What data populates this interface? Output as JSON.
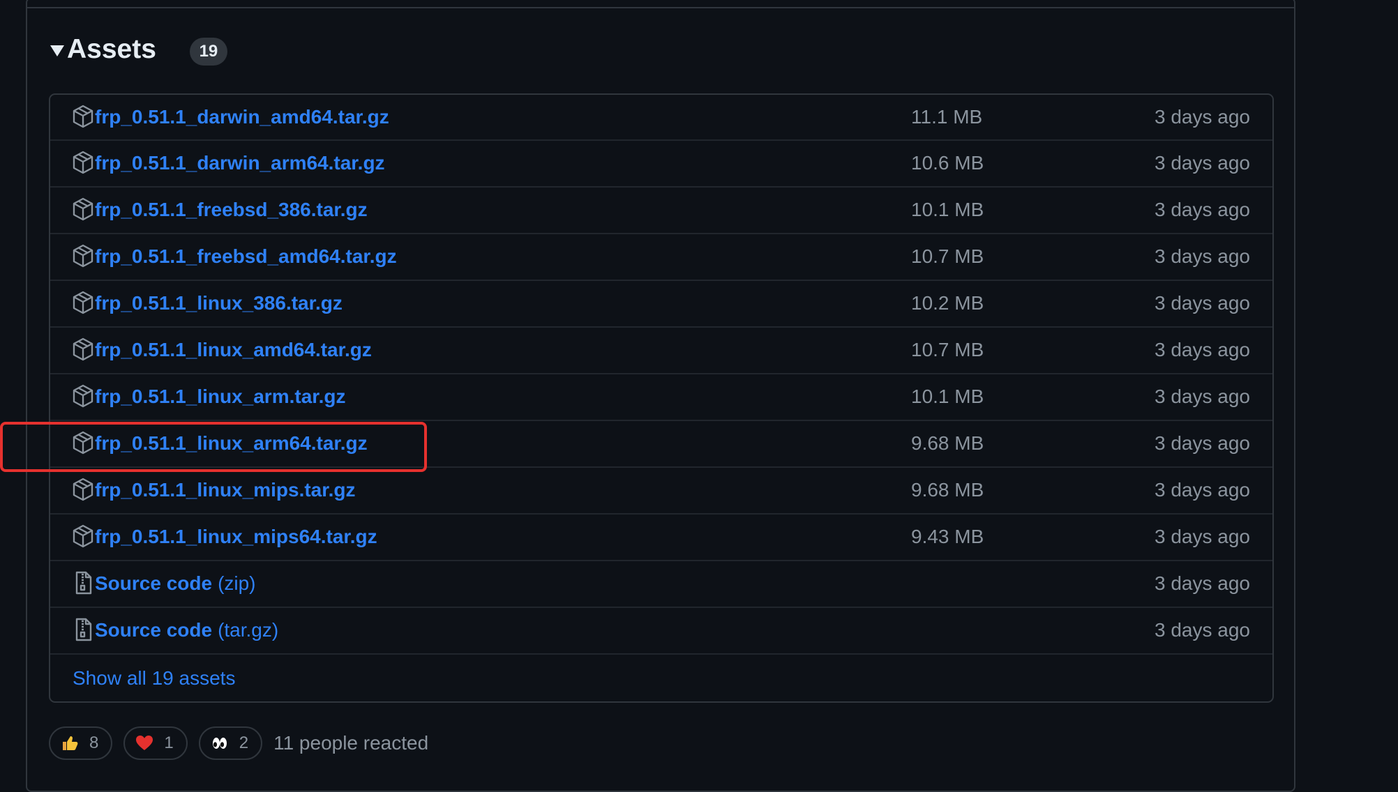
{
  "assets": {
    "title": "Assets",
    "count": "19",
    "items": [
      {
        "name": "frp_0.51.1_darwin_amd64.tar.gz",
        "suffix": "",
        "size": "11.1 MB",
        "time": "3 days ago",
        "icon": "package-icon"
      },
      {
        "name": "frp_0.51.1_darwin_arm64.tar.gz",
        "suffix": "",
        "size": "10.6 MB",
        "time": "3 days ago",
        "icon": "package-icon"
      },
      {
        "name": "frp_0.51.1_freebsd_386.tar.gz",
        "suffix": "",
        "size": "10.1 MB",
        "time": "3 days ago",
        "icon": "package-icon"
      },
      {
        "name": "frp_0.51.1_freebsd_amd64.tar.gz",
        "suffix": "",
        "size": "10.7 MB",
        "time": "3 days ago",
        "icon": "package-icon"
      },
      {
        "name": "frp_0.51.1_linux_386.tar.gz",
        "suffix": "",
        "size": "10.2 MB",
        "time": "3 days ago",
        "icon": "package-icon"
      },
      {
        "name": "frp_0.51.1_linux_amd64.tar.gz",
        "suffix": "",
        "size": "10.7 MB",
        "time": "3 days ago",
        "icon": "package-icon"
      },
      {
        "name": "frp_0.51.1_linux_arm.tar.gz",
        "suffix": "",
        "size": "10.1 MB",
        "time": "3 days ago",
        "icon": "package-icon"
      },
      {
        "name": "frp_0.51.1_linux_arm64.tar.gz",
        "suffix": "",
        "size": "9.68 MB",
        "time": "3 days ago",
        "icon": "package-icon"
      },
      {
        "name": "frp_0.51.1_linux_mips.tar.gz",
        "suffix": "",
        "size": "9.68 MB",
        "time": "3 days ago",
        "icon": "package-icon"
      },
      {
        "name": "frp_0.51.1_linux_mips64.tar.gz",
        "suffix": "",
        "size": "9.43 MB",
        "time": "3 days ago",
        "icon": "package-icon"
      },
      {
        "name": "Source code",
        "suffix": "(zip)",
        "size": "",
        "time": "3 days ago",
        "icon": "file-zip-icon"
      },
      {
        "name": "Source code",
        "suffix": "(tar.gz)",
        "size": "",
        "time": "3 days ago",
        "icon": "file-zip-icon"
      }
    ],
    "show_all": "Show all 19 assets"
  },
  "reactions": {
    "items": [
      {
        "emoji": "thumbs-up-icon",
        "count": "8"
      },
      {
        "emoji": "heart-icon",
        "count": "1"
      },
      {
        "emoji": "eyes-icon",
        "count": "2"
      }
    ],
    "summary": "11 people reacted"
  },
  "colors": {
    "background": "#0d1117",
    "border": "#30363d",
    "link": "#2f81f7",
    "muted": "#8b949e",
    "highlight": "#e5312e"
  }
}
